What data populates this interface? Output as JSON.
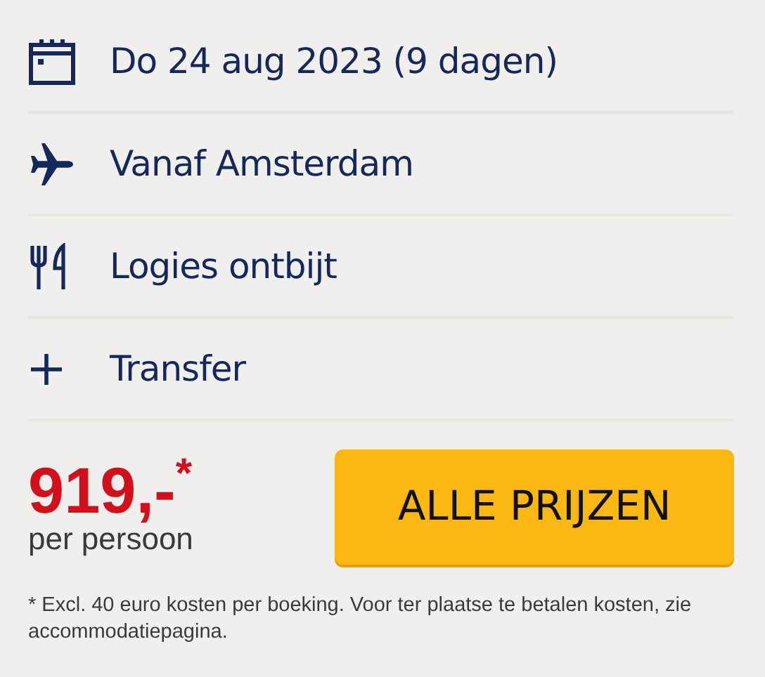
{
  "features": [
    {
      "kind": "calendar",
      "text": "Do 24 aug 2023 (9 dagen)"
    },
    {
      "kind": "plane",
      "text": "Vanaf Amsterdam"
    },
    {
      "kind": "meal",
      "text": "Logies ontbijt"
    },
    {
      "kind": "plus",
      "text": "Transfer"
    }
  ],
  "price": {
    "amount": "919,-$^{*}$",
    "unit": "per persoon"
  },
  "button": "ALLE PRIJZEN",
  "footnote": "* Excl. 40 euro kosten per boeking. Voor ter plaatse te betalen kosten, zie accommodatiepagina."
}
